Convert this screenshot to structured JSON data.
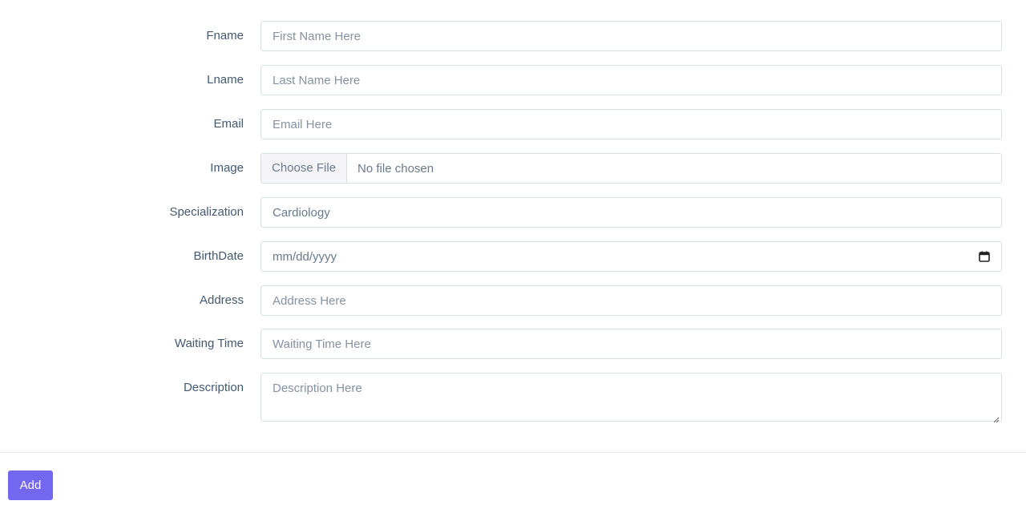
{
  "form": {
    "fname": {
      "label": "Fname",
      "placeholder": "First Name Here"
    },
    "lname": {
      "label": "Lname",
      "placeholder": "Last Name Here"
    },
    "email": {
      "label": "Email",
      "placeholder": "Email Here"
    },
    "image": {
      "label": "Image",
      "button_label": "Choose File",
      "status_text": "No file chosen"
    },
    "specialization": {
      "label": "Specialization",
      "value": "Cardiology"
    },
    "birthdate": {
      "label": "BirthDate",
      "placeholder": "mm/dd/yyyy",
      "icon": "calendar-icon"
    },
    "address": {
      "label": "Address",
      "placeholder": "Address Here"
    },
    "waiting_time": {
      "label": "Waiting Time",
      "placeholder": "Waiting Time Here"
    },
    "description": {
      "label": "Description",
      "placeholder": "Description Here"
    }
  },
  "actions": {
    "add_label": "Add"
  },
  "colors": {
    "primary": "#7367f0",
    "border": "#d9dee3",
    "label": "#435971",
    "placeholder": "#8592a3"
  }
}
